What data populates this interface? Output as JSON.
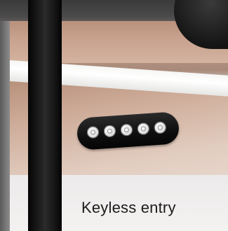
{
  "caption": "Keyless entry",
  "keypad": {
    "key_count": 5
  },
  "colors": {
    "body_paint": "#c7a18d",
    "pillar": "#1a1a1a",
    "keypad": "#0f0f0f",
    "caption_text": "#1c1c1c"
  }
}
